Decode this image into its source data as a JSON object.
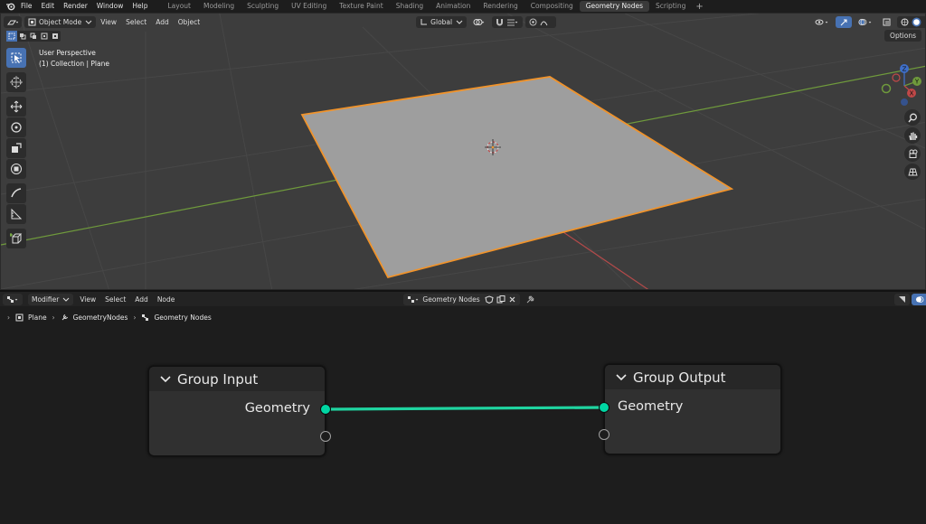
{
  "menubar": {
    "items": [
      "File",
      "Edit",
      "Render",
      "Window",
      "Help"
    ],
    "workspaces": [
      "Layout",
      "Modeling",
      "Sculpting",
      "UV Editing",
      "Texture Paint",
      "Shading",
      "Animation",
      "Rendering",
      "Compositing",
      "Geometry Nodes",
      "Scripting"
    ],
    "active_workspace": "Geometry Nodes",
    "add_tab": "+"
  },
  "viewport": {
    "mode": "Object Mode",
    "menus": [
      "View",
      "Select",
      "Add",
      "Object"
    ],
    "orientation": "Global",
    "options_label": "Options",
    "perspective_label": "User Perspective",
    "collection_label": "(1) Collection | Plane",
    "gizmo_axes": [
      "Z",
      "Y",
      "X"
    ],
    "colors": {
      "background": "#3d3d3d",
      "plane_fill": "#9e9e9e",
      "selection_outline": "#f0932b",
      "x_axis": "#b34a4a",
      "y_axis": "#6f9a3c",
      "active_tool": "#4772b3"
    }
  },
  "node_editor": {
    "editor_type": "Modifier",
    "menus": [
      "View",
      "Select",
      "Add",
      "Node"
    ],
    "node_group": "Geometry Nodes",
    "breadcrumb": [
      "Plane",
      "GeometryNodes",
      "Geometry Nodes"
    ],
    "nodes": {
      "group_input": {
        "title": "Group Input",
        "socket": "Geometry"
      },
      "group_output": {
        "title": "Group Output",
        "socket": "Geometry"
      }
    },
    "colors": {
      "link": "#1fd4a0",
      "geometry_socket": "#00d6a3"
    }
  }
}
